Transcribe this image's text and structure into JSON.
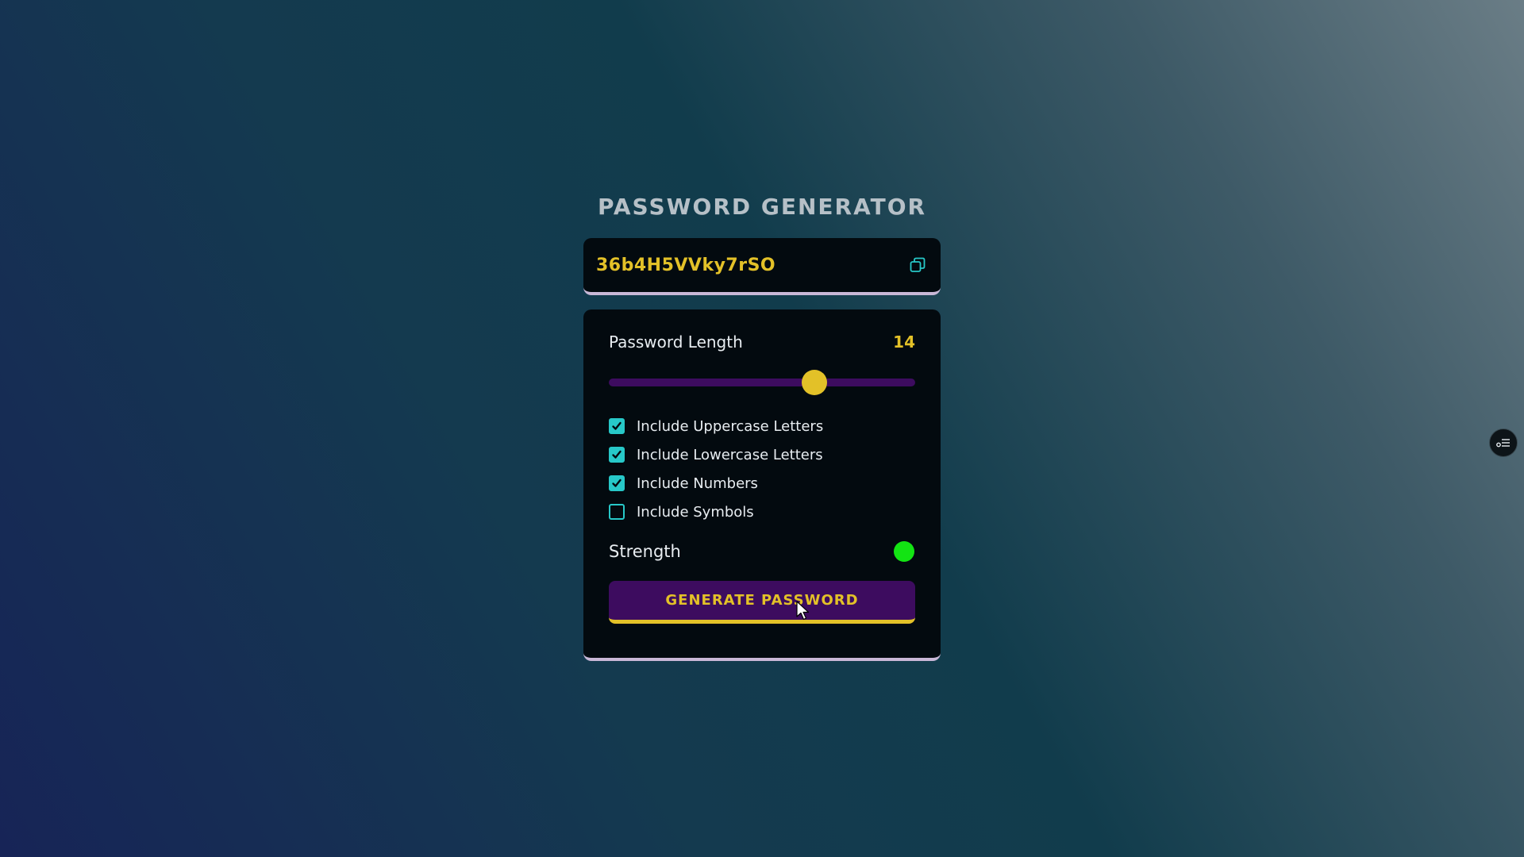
{
  "title": "PASSWORD GENERATOR",
  "password": {
    "value": "36b4H5VVky7rSO",
    "copy_icon": "copy-icon"
  },
  "length": {
    "label": "Password Length",
    "value": "14",
    "slider_fraction": 0.67
  },
  "options": [
    {
      "label": "Include Uppercase Letters",
      "checked": true
    },
    {
      "label": "Include Lowercase Letters",
      "checked": true
    },
    {
      "label": "Include Numbers",
      "checked": true
    },
    {
      "label": "Include Symbols",
      "checked": false
    }
  ],
  "strength": {
    "label": "Strength",
    "color": "#13e413"
  },
  "generate_button": {
    "label": "GENERATE PASSWORD"
  },
  "colors": {
    "accent_yellow": "#e3c128",
    "accent_purple": "#3d0c5f",
    "checkbox_teal": "#27c8c8",
    "panel_bg": "#030a0f"
  },
  "side_widget_icon": "settings-sliders-icon"
}
